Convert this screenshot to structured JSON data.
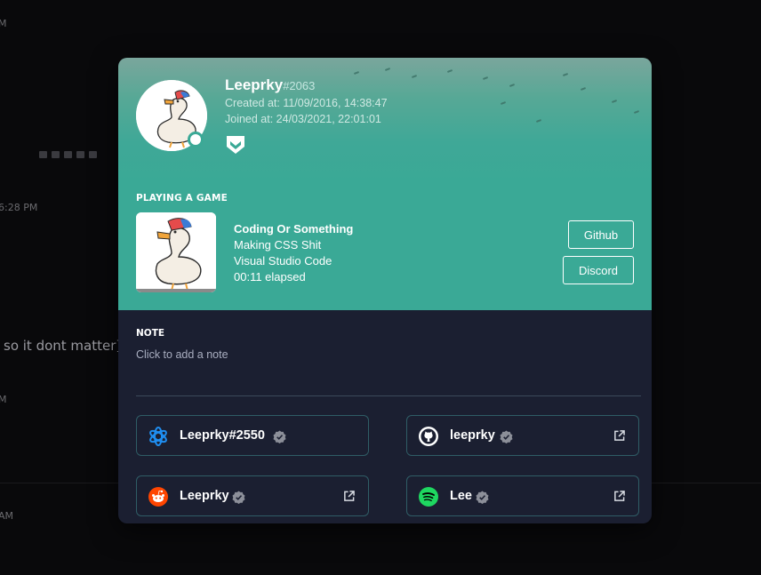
{
  "background": {
    "fragments": [
      "M",
      "6:28 PM",
      "so it dont matter]",
      "M",
      "AM"
    ]
  },
  "profile": {
    "name": "Leeprky",
    "discriminator": "#2063",
    "created": "Created at: 11/09/2016, 14:38:47",
    "joined": "Joined at: 24/03/2021, 22:01:01",
    "badge_icon": "hypesquad-icon",
    "status": "online"
  },
  "activity": {
    "heading": "PLAYING A GAME",
    "name": "Coding Or Something",
    "details": "Making CSS Shit",
    "state": "Visual Studio Code",
    "elapsed": "00:11 elapsed",
    "buttons": [
      "Github",
      "Discord"
    ]
  },
  "note": {
    "heading": "NOTE",
    "placeholder": "Click to add a note"
  },
  "connections": [
    {
      "service_icon": "battlenet-icon",
      "name": "Leeprky#2550",
      "external": false
    },
    {
      "service_icon": "github-icon",
      "name": "leeprky",
      "external": true
    },
    {
      "service_icon": "reddit-icon",
      "name": "Leeprky",
      "external": true
    },
    {
      "service_icon": "spotify-icon",
      "name": "Lee",
      "external": true
    }
  ],
  "colors": {
    "header_teal": "#3aa996",
    "panel_bg": "#1b1f31",
    "connection_border": "#2f5d66"
  }
}
